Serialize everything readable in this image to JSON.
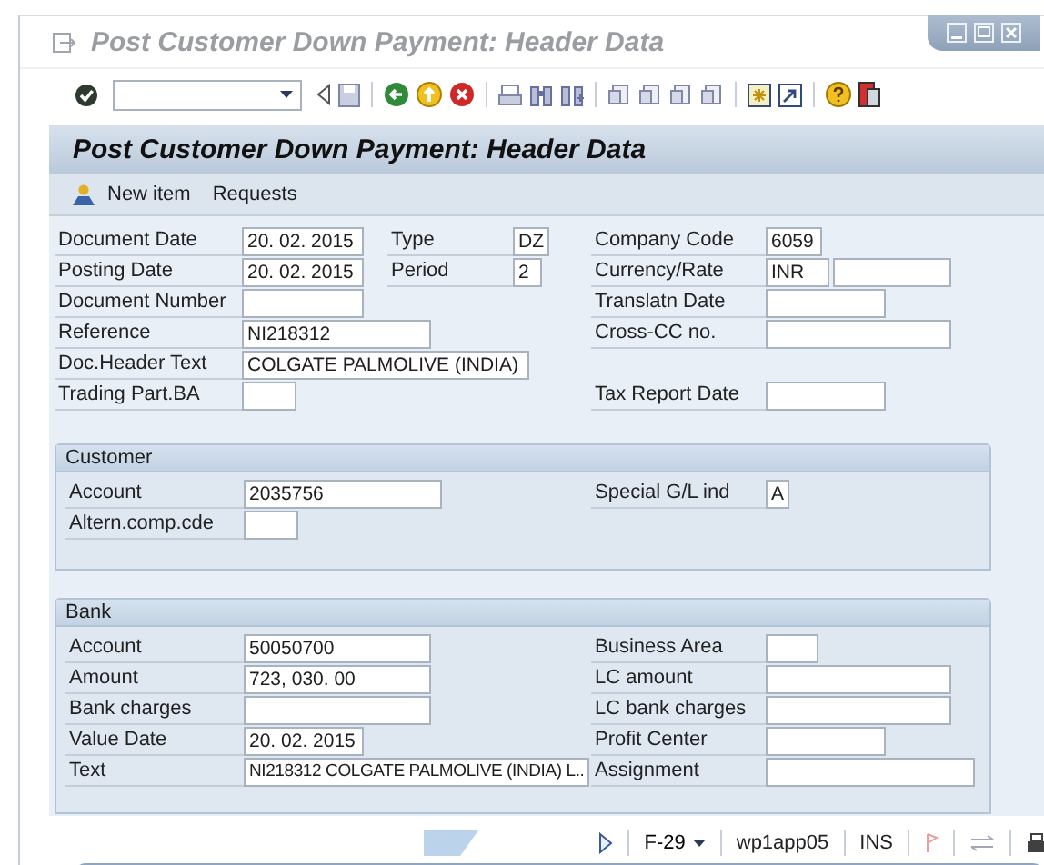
{
  "window": {
    "title": "Post Customer Down Payment: Header Data"
  },
  "screen_title": "Post Customer Down Payment: Header Data",
  "app_toolbar": [
    {
      "label": "New item",
      "kind": "icon_button"
    },
    {
      "label": "Requests",
      "kind": "text_button"
    }
  ],
  "header": {
    "rows": [
      {
        "left": {
          "label": "Document Date",
          "fields": [
            {
              "kind": "filled",
              "value": "20. 02. 2015"
            }
          ]
        },
        "middle": {
          "label": "Type",
          "fields": [
            {
              "kind": "filled",
              "value": "DZ"
            }
          ]
        },
        "right": {
          "label": "Company Code",
          "fields": [
            {
              "kind": "filled",
              "value": "6059"
            }
          ]
        }
      },
      {
        "left": {
          "label": "Posting Date",
          "fields": [
            {
              "kind": "filled",
              "value": "20. 02. 2015"
            }
          ]
        },
        "middle": {
          "label": "Period",
          "fields": [
            {
              "kind": "filled",
              "value": "2"
            }
          ]
        },
        "right": {
          "label": "Currency/Rate",
          "fields": [
            {
              "kind": "filled",
              "value": "INR"
            },
            {
              "kind": "blank"
            }
          ]
        }
      },
      {
        "left": {
          "label": "Document Number",
          "fields": [
            {
              "kind": "blank"
            }
          ]
        },
        "right": {
          "label": "Translatn Date",
          "fields": [
            {
              "kind": "blank"
            }
          ]
        }
      },
      {
        "left": {
          "label": "Reference",
          "fields": [
            {
              "kind": "filled",
              "value": "NI218312"
            }
          ]
        },
        "right": {
          "label": "Cross-CC no.",
          "fields": [
            {
              "kind": "blank"
            }
          ]
        }
      },
      {
        "left": {
          "label": "Doc.Header Text",
          "fields": [
            {
              "kind": "filled",
              "value": "COLGATE PALMOLIVE (INDIA)"
            }
          ]
        }
      },
      {
        "left": {
          "label": "Trading Part.BA",
          "fields": [
            {
              "kind": "blank"
            }
          ]
        },
        "right": {
          "label": "Tax Report Date",
          "fields": [
            {
              "kind": "blank"
            }
          ]
        }
      }
    ]
  },
  "customer": {
    "title": "Customer",
    "rows": [
      {
        "left": {
          "label": "Account",
          "fields": [
            {
              "kind": "filled",
              "value": "2035756"
            }
          ]
        },
        "right": {
          "label": "Special G/L ind",
          "fields": [
            {
              "kind": "filled",
              "value": "A"
            }
          ]
        }
      },
      {
        "left": {
          "label": "Altern.comp.cde",
          "fields": [
            {
              "kind": "blank"
            }
          ]
        }
      }
    ]
  },
  "bank": {
    "title": "Bank",
    "rows": [
      {
        "left": {
          "label": "Account",
          "fields": [
            {
              "kind": "filled",
              "value": "50050700"
            }
          ]
        },
        "right": {
          "label": "Business Area",
          "fields": [
            {
              "kind": "blank"
            }
          ]
        }
      },
      {
        "left": {
          "label": "Amount",
          "fields": [
            {
              "kind": "filled",
              "value": "723, 030. 00"
            }
          ]
        },
        "right": {
          "label": "LC amount",
          "fields": [
            {
              "kind": "blank"
            }
          ]
        }
      },
      {
        "left": {
          "label": "Bank charges",
          "fields": [
            {
              "kind": "blank"
            }
          ]
        },
        "right": {
          "label": "LC bank charges",
          "fields": [
            {
              "kind": "blank"
            }
          ]
        }
      },
      {
        "left": {
          "label": "Value Date",
          "fields": [
            {
              "kind": "filled",
              "value": "20. 02. 2015"
            }
          ]
        },
        "right": {
          "label": "Profit Center",
          "fields": [
            {
              "kind": "blank"
            }
          ]
        }
      },
      {
        "left": {
          "label": "Text",
          "fields": [
            {
              "kind": "filled",
              "value": "NI218312 COLGATE PALMOLIVE (INDIA) L.."
            }
          ]
        },
        "right": {
          "label": "Assignment",
          "fields": [
            {
              "kind": "blank"
            }
          ]
        }
      }
    ]
  },
  "status_bar": {
    "transaction": "F-29",
    "server": "wp1app05",
    "mode": "INS"
  }
}
